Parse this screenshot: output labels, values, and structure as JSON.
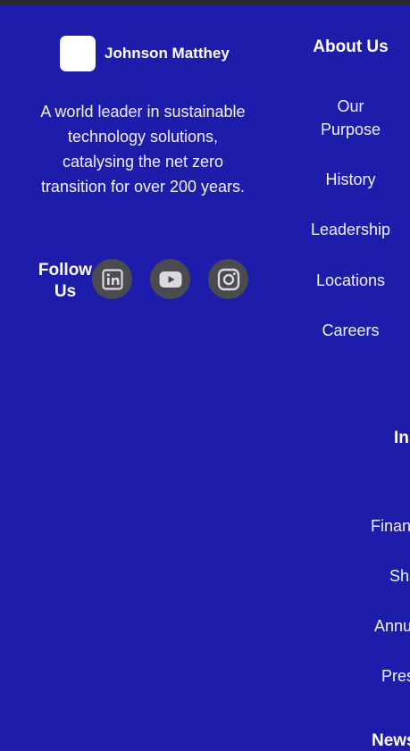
{
  "brand": {
    "name": "Johnson Matthey",
    "tagline": "A world leader in sustainable technology solutions, catalysing the net zero transition for over 200 years."
  },
  "social": {
    "follow_label": "Follow Us",
    "icons": [
      "linkedin-icon",
      "youtube-icon",
      "instagram-icon"
    ]
  },
  "about": {
    "heading": "About Us",
    "links": [
      "Our Purpose",
      "History",
      "Leadership",
      "Locations",
      "Careers"
    ]
  },
  "investors": {
    "heading": "In",
    "links": [
      "Finan",
      "Sha",
      "Annu",
      "Pres"
    ]
  },
  "news": {
    "heading": "News"
  },
  "colors": {
    "background": "#1e1caa",
    "social_circle": "#4a4a4f",
    "top_bar": "#2a2a2e"
  }
}
